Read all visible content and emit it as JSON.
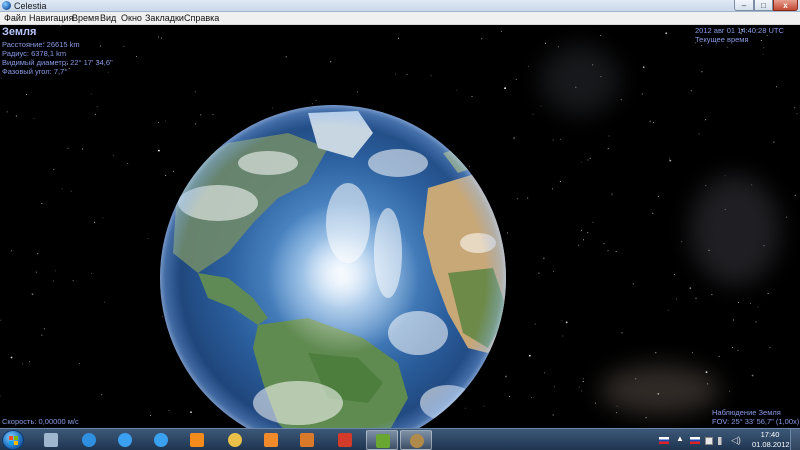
{
  "window": {
    "title": "Celestia",
    "min_label": "–",
    "max_label": "□",
    "close_label": "x"
  },
  "menu": [
    {
      "label": "Файл"
    },
    {
      "label": "Навигация"
    },
    {
      "label": "Время"
    },
    {
      "label": "Вид"
    },
    {
      "label": "Окно"
    },
    {
      "label": "Закладки"
    },
    {
      "label": "Справка"
    }
  ],
  "object_info": {
    "name": "Земля",
    "distance": "Расстояние: 26615 km",
    "radius": "Радиус: 6378,1 km",
    "apparent_diameter": "Видимый диаметр: 22° 17' 34,6\"",
    "phase_angle": "Фазовый угол: 7,7°"
  },
  "time_info": {
    "datetime": "2012 авг 01 14:40:28 UTC",
    "mode": "Текущее время"
  },
  "speed": "Скорость: 0,00000 м/с",
  "view_info": {
    "observing": "Наблюдение Земля",
    "fov": "FOV: 25° 33' 56,7\" (1,00x)"
  },
  "taskbar": {
    "apps": [
      {
        "icon": "calculator-icon",
        "color": "#9fb6cf"
      },
      {
        "icon": "internet-explorer-icon",
        "color": "#2f8fe0"
      },
      {
        "icon": "internet-explorer-window-icon",
        "color": "#3aa0f0"
      },
      {
        "icon": "internet-explorer-window-icon",
        "color": "#3aa0f0"
      },
      {
        "icon": "odnoklassniki-icon",
        "color": "#f28b1c"
      },
      {
        "icon": "file-explorer-icon",
        "color": "#e8c04a"
      },
      {
        "icon": "media-player-icon",
        "color": "#f08a2a"
      },
      {
        "icon": "paint-icon",
        "color": "#d97a2a"
      },
      {
        "icon": "game-icon",
        "color": "#d23a2a"
      },
      {
        "icon": "nvidia-icon",
        "color": "#6aa632",
        "active": true
      },
      {
        "icon": "celestia-icon",
        "color": "#b08a4a",
        "active": true
      }
    ],
    "clock_time": "17:40",
    "clock_date": "01.08.2012",
    "tray": [
      "flag-ru-icon",
      "flag-ru-icon",
      "notification-arrow-icon",
      "flag-icon",
      "network-icon",
      "volume-icon"
    ]
  }
}
